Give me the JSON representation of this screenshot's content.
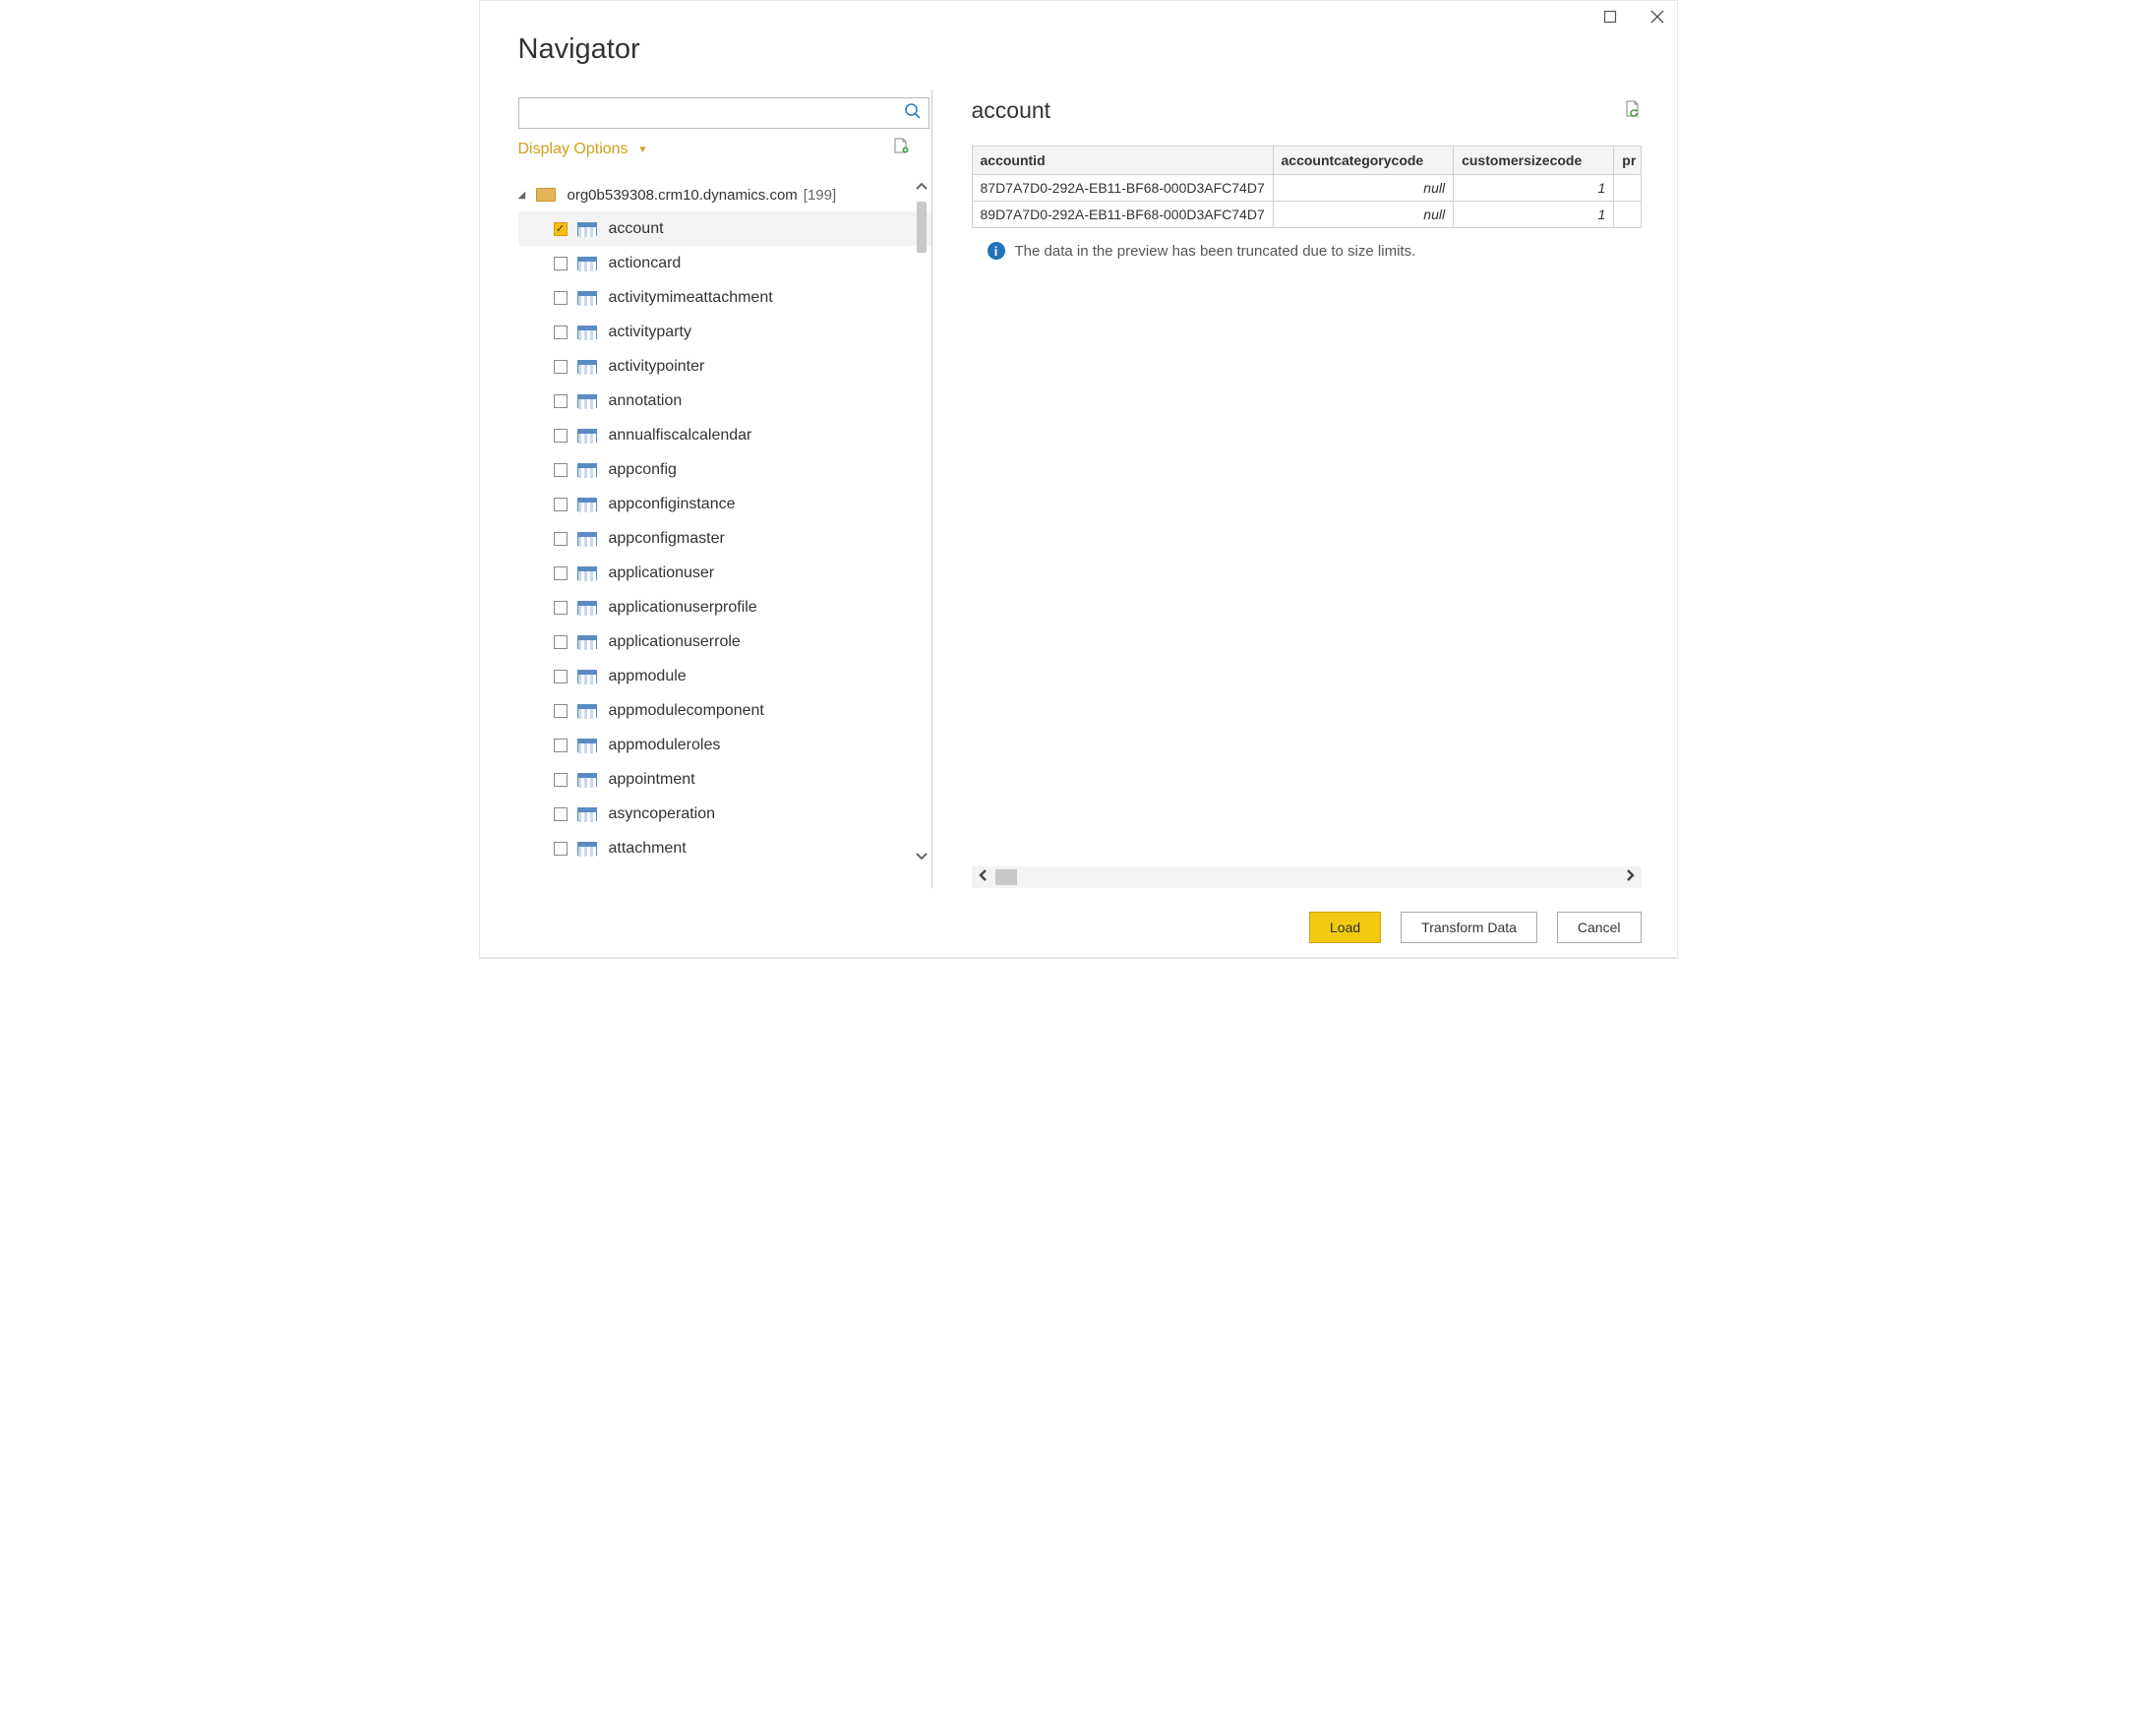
{
  "window": {
    "title": "Navigator"
  },
  "search": {
    "placeholder": ""
  },
  "displayOptions": {
    "label": "Display Options"
  },
  "tree": {
    "root": {
      "label": "org0b539308.crm10.dynamics.com",
      "count": "[199]"
    },
    "items": [
      {
        "label": "account",
        "checked": true
      },
      {
        "label": "actioncard",
        "checked": false
      },
      {
        "label": "activitymimeattachment",
        "checked": false
      },
      {
        "label": "activityparty",
        "checked": false
      },
      {
        "label": "activitypointer",
        "checked": false
      },
      {
        "label": "annotation",
        "checked": false
      },
      {
        "label": "annualfiscalcalendar",
        "checked": false
      },
      {
        "label": "appconfig",
        "checked": false
      },
      {
        "label": "appconfiginstance",
        "checked": false
      },
      {
        "label": "appconfigmaster",
        "checked": false
      },
      {
        "label": "applicationuser",
        "checked": false
      },
      {
        "label": "applicationuserprofile",
        "checked": false
      },
      {
        "label": "applicationuserrole",
        "checked": false
      },
      {
        "label": "appmodule",
        "checked": false
      },
      {
        "label": "appmodulecomponent",
        "checked": false
      },
      {
        "label": "appmoduleroles",
        "checked": false
      },
      {
        "label": "appointment",
        "checked": false
      },
      {
        "label": "asyncoperation",
        "checked": false
      },
      {
        "label": "attachment",
        "checked": false
      }
    ]
  },
  "preview": {
    "title": "account",
    "columns": [
      "accountid",
      "accountcategorycode",
      "customersizecode",
      "pr"
    ],
    "rows": [
      {
        "accountid": "87D7A7D0-292A-EB11-BF68-000D3AFC74D7",
        "accountcategorycode": "null",
        "customersizecode": "1"
      },
      {
        "accountid": "89D7A7D0-292A-EB11-BF68-000D3AFC74D7",
        "accountcategorycode": "null",
        "customersizecode": "1"
      }
    ],
    "info": "The data in the preview has been truncated due to size limits."
  },
  "buttons": {
    "load": "Load",
    "transform": "Transform Data",
    "cancel": "Cancel"
  }
}
